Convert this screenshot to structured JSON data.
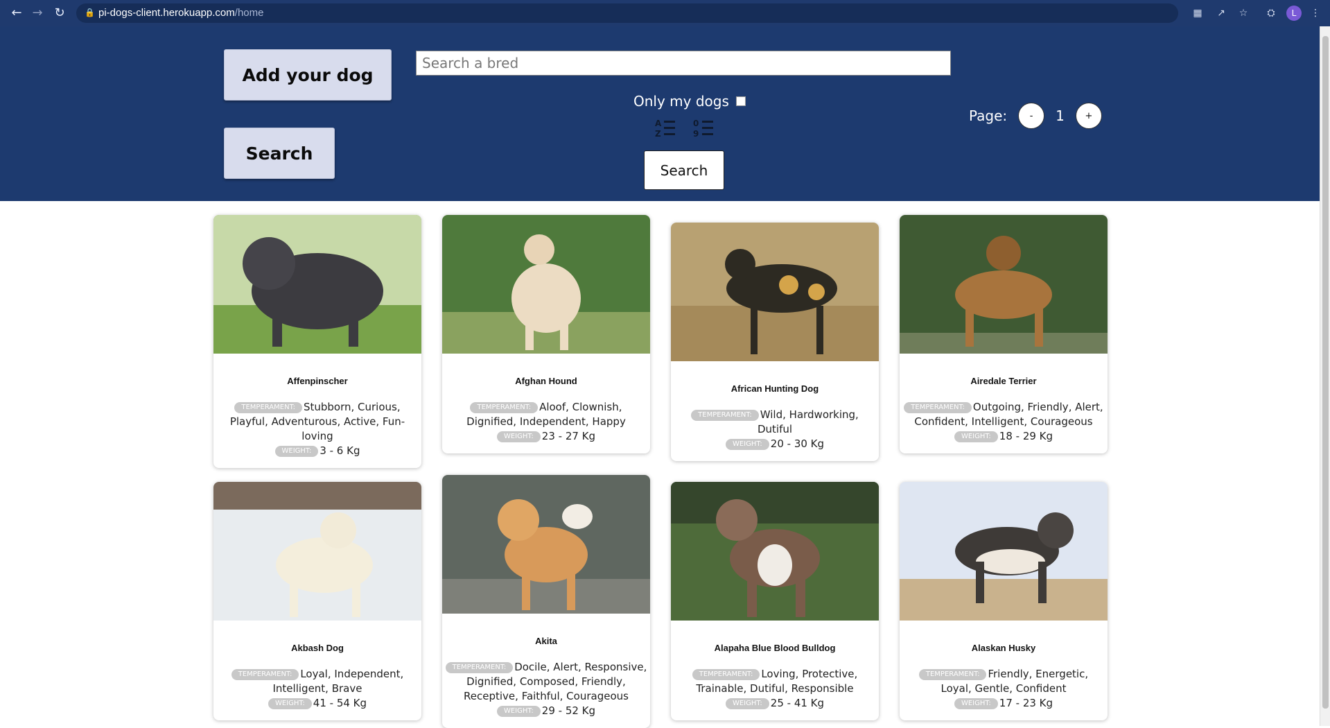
{
  "browser": {
    "url_host": "pi-dogs-client.herokuapp.com",
    "url_path": "/home",
    "profile_initial": "L"
  },
  "header": {
    "add_dog_label": "Add your dog",
    "search_big_label": "Search",
    "search_placeholder": "Search a bred",
    "only_mine_label": "Only my dogs",
    "search_small_label": "Search",
    "page_label": "Page:",
    "page_prev": "-",
    "page_number": "1",
    "page_next": "+"
  },
  "labels": {
    "temperament": "TEMPERAMENT:",
    "weight": "WEIGHT:"
  },
  "dogs": [
    {
      "name": "Affenpinscher",
      "temperament": "Stubborn, Curious, Playful, Adventurous, Active, Fun-loving",
      "weight": "3 - 6 Kg",
      "bg": "#5b8a3a"
    },
    {
      "name": "Afghan Hound",
      "temperament": "Aloof, Clownish, Dignified, Independent, Happy",
      "weight": "23 - 27 Kg",
      "bg": "#4f7a3c"
    },
    {
      "name": "African Hunting Dog",
      "temperament": "Wild, Hardworking, Dutiful",
      "weight": "20 - 30 Kg",
      "bg": "#b39b6c"
    },
    {
      "name": "Airedale Terrier",
      "temperament": "Outgoing, Friendly, Alert, Confident, Intelligent, Courageous",
      "weight": "18 - 29 Kg",
      "bg": "#3f5a33"
    },
    {
      "name": "Akbash Dog",
      "temperament": "Loyal, Independent, Intelligent, Brave",
      "weight": "41 - 54 Kg",
      "bg": "#e8ecef"
    },
    {
      "name": "Akita",
      "temperament": "Docile, Alert, Responsive, Dignified, Composed, Friendly, Receptive, Faithful, Courageous",
      "weight": "29 - 52 Kg",
      "bg": "#57605a"
    },
    {
      "name": "Alapaha Blue Blood Bulldog",
      "temperament": "Loving, Protective, Trainable, Dutiful, Responsible",
      "weight": "25 - 41 Kg",
      "bg": "#4e6b3a"
    },
    {
      "name": "Alaskan Husky",
      "temperament": "Friendly, Energetic, Loyal, Gentle, Confident",
      "weight": "17 - 23 Kg",
      "bg": "#dfe6f2"
    }
  ]
}
